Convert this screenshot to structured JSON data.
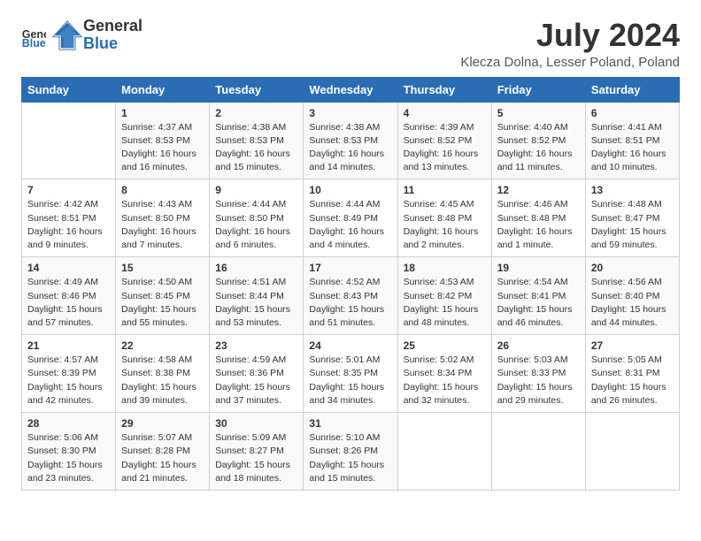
{
  "logo": {
    "text_general": "General",
    "text_blue": "Blue"
  },
  "title": "July 2024",
  "subtitle": "Klecza Dolna, Lesser Poland, Poland",
  "days_header": [
    "Sunday",
    "Monday",
    "Tuesday",
    "Wednesday",
    "Thursday",
    "Friday",
    "Saturday"
  ],
  "weeks": [
    [
      {
        "day": "",
        "text": ""
      },
      {
        "day": "1",
        "text": "Sunrise: 4:37 AM\nSunset: 8:53 PM\nDaylight: 16 hours\nand 16 minutes."
      },
      {
        "day": "2",
        "text": "Sunrise: 4:38 AM\nSunset: 8:53 PM\nDaylight: 16 hours\nand 15 minutes."
      },
      {
        "day": "3",
        "text": "Sunrise: 4:38 AM\nSunset: 8:53 PM\nDaylight: 16 hours\nand 14 minutes."
      },
      {
        "day": "4",
        "text": "Sunrise: 4:39 AM\nSunset: 8:52 PM\nDaylight: 16 hours\nand 13 minutes."
      },
      {
        "day": "5",
        "text": "Sunrise: 4:40 AM\nSunset: 8:52 PM\nDaylight: 16 hours\nand 11 minutes."
      },
      {
        "day": "6",
        "text": "Sunrise: 4:41 AM\nSunset: 8:51 PM\nDaylight: 16 hours\nand 10 minutes."
      }
    ],
    [
      {
        "day": "7",
        "text": "Sunrise: 4:42 AM\nSunset: 8:51 PM\nDaylight: 16 hours\nand 9 minutes."
      },
      {
        "day": "8",
        "text": "Sunrise: 4:43 AM\nSunset: 8:50 PM\nDaylight: 16 hours\nand 7 minutes."
      },
      {
        "day": "9",
        "text": "Sunrise: 4:44 AM\nSunset: 8:50 PM\nDaylight: 16 hours\nand 6 minutes."
      },
      {
        "day": "10",
        "text": "Sunrise: 4:44 AM\nSunset: 8:49 PM\nDaylight: 16 hours\nand 4 minutes."
      },
      {
        "day": "11",
        "text": "Sunrise: 4:45 AM\nSunset: 8:48 PM\nDaylight: 16 hours\nand 2 minutes."
      },
      {
        "day": "12",
        "text": "Sunrise: 4:46 AM\nSunset: 8:48 PM\nDaylight: 16 hours\nand 1 minute."
      },
      {
        "day": "13",
        "text": "Sunrise: 4:48 AM\nSunset: 8:47 PM\nDaylight: 15 hours\nand 59 minutes."
      }
    ],
    [
      {
        "day": "14",
        "text": "Sunrise: 4:49 AM\nSunset: 8:46 PM\nDaylight: 15 hours\nand 57 minutes."
      },
      {
        "day": "15",
        "text": "Sunrise: 4:50 AM\nSunset: 8:45 PM\nDaylight: 15 hours\nand 55 minutes."
      },
      {
        "day": "16",
        "text": "Sunrise: 4:51 AM\nSunset: 8:44 PM\nDaylight: 15 hours\nand 53 minutes."
      },
      {
        "day": "17",
        "text": "Sunrise: 4:52 AM\nSunset: 8:43 PM\nDaylight: 15 hours\nand 51 minutes."
      },
      {
        "day": "18",
        "text": "Sunrise: 4:53 AM\nSunset: 8:42 PM\nDaylight: 15 hours\nand 48 minutes."
      },
      {
        "day": "19",
        "text": "Sunrise: 4:54 AM\nSunset: 8:41 PM\nDaylight: 15 hours\nand 46 minutes."
      },
      {
        "day": "20",
        "text": "Sunrise: 4:56 AM\nSunset: 8:40 PM\nDaylight: 15 hours\nand 44 minutes."
      }
    ],
    [
      {
        "day": "21",
        "text": "Sunrise: 4:57 AM\nSunset: 8:39 PM\nDaylight: 15 hours\nand 42 minutes."
      },
      {
        "day": "22",
        "text": "Sunrise: 4:58 AM\nSunset: 8:38 PM\nDaylight: 15 hours\nand 39 minutes."
      },
      {
        "day": "23",
        "text": "Sunrise: 4:59 AM\nSunset: 8:36 PM\nDaylight: 15 hours\nand 37 minutes."
      },
      {
        "day": "24",
        "text": "Sunrise: 5:01 AM\nSunset: 8:35 PM\nDaylight: 15 hours\nand 34 minutes."
      },
      {
        "day": "25",
        "text": "Sunrise: 5:02 AM\nSunset: 8:34 PM\nDaylight: 15 hours\nand 32 minutes."
      },
      {
        "day": "26",
        "text": "Sunrise: 5:03 AM\nSunset: 8:33 PM\nDaylight: 15 hours\nand 29 minutes."
      },
      {
        "day": "27",
        "text": "Sunrise: 5:05 AM\nSunset: 8:31 PM\nDaylight: 15 hours\nand 26 minutes."
      }
    ],
    [
      {
        "day": "28",
        "text": "Sunrise: 5:06 AM\nSunset: 8:30 PM\nDaylight: 15 hours\nand 23 minutes."
      },
      {
        "day": "29",
        "text": "Sunrise: 5:07 AM\nSunset: 8:28 PM\nDaylight: 15 hours\nand 21 minutes."
      },
      {
        "day": "30",
        "text": "Sunrise: 5:09 AM\nSunset: 8:27 PM\nDaylight: 15 hours\nand 18 minutes."
      },
      {
        "day": "31",
        "text": "Sunrise: 5:10 AM\nSunset: 8:26 PM\nDaylight: 15 hours\nand 15 minutes."
      },
      {
        "day": "",
        "text": ""
      },
      {
        "day": "",
        "text": ""
      },
      {
        "day": "",
        "text": ""
      }
    ]
  ]
}
